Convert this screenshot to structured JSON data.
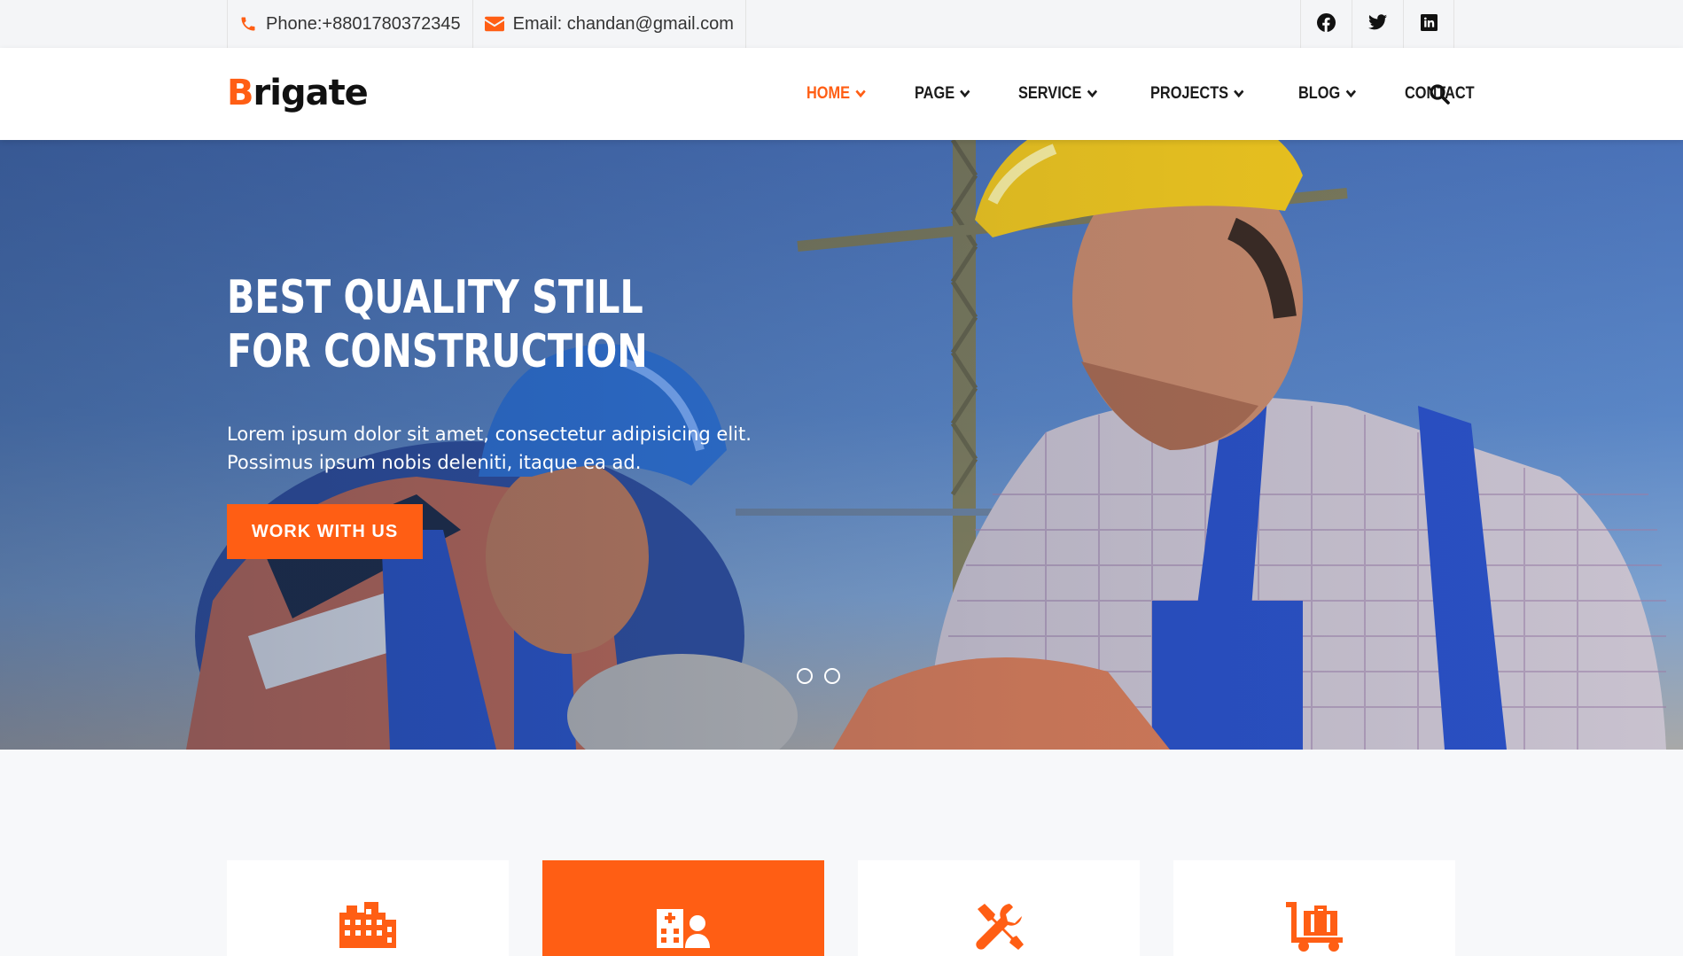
{
  "topbar": {
    "phone": "Phone:+8801780372345",
    "email": "Email: chandan@gmail.com",
    "socials": [
      "facebook-icon",
      "twitter-icon",
      "linkedin-icon"
    ]
  },
  "header": {
    "logo_first": "B",
    "logo_rest": "rigate",
    "nav": [
      {
        "label": "HOME",
        "active": true,
        "dropdown": true
      },
      {
        "label": "PAGE",
        "active": false,
        "dropdown": true
      },
      {
        "label": "SERVICE",
        "active": false,
        "dropdown": true
      },
      {
        "label": "PROJECTS",
        "active": false,
        "dropdown": true
      },
      {
        "label": "BLOG",
        "active": false,
        "dropdown": true
      },
      {
        "label": "CONTACT",
        "active": false,
        "dropdown": false
      }
    ]
  },
  "hero": {
    "title": "BEST QUALITY STILL FOR CONSTRUCTION",
    "text": "Lorem ipsum dolor sit amet, consectetur adipisicing elit. Possimus ipsum nobis deleniti, itaque ea ad.",
    "button": "WORK WITH US",
    "slides": 2
  },
  "cards": [
    {
      "icon": "building-icon",
      "active": false
    },
    {
      "icon": "hospital-user-icon",
      "active": true
    },
    {
      "icon": "tools-icon",
      "active": false
    },
    {
      "icon": "luggage-cart-icon",
      "active": false
    }
  ],
  "colors": {
    "accent": "#ff5e14",
    "dark": "#1b1b1b"
  }
}
